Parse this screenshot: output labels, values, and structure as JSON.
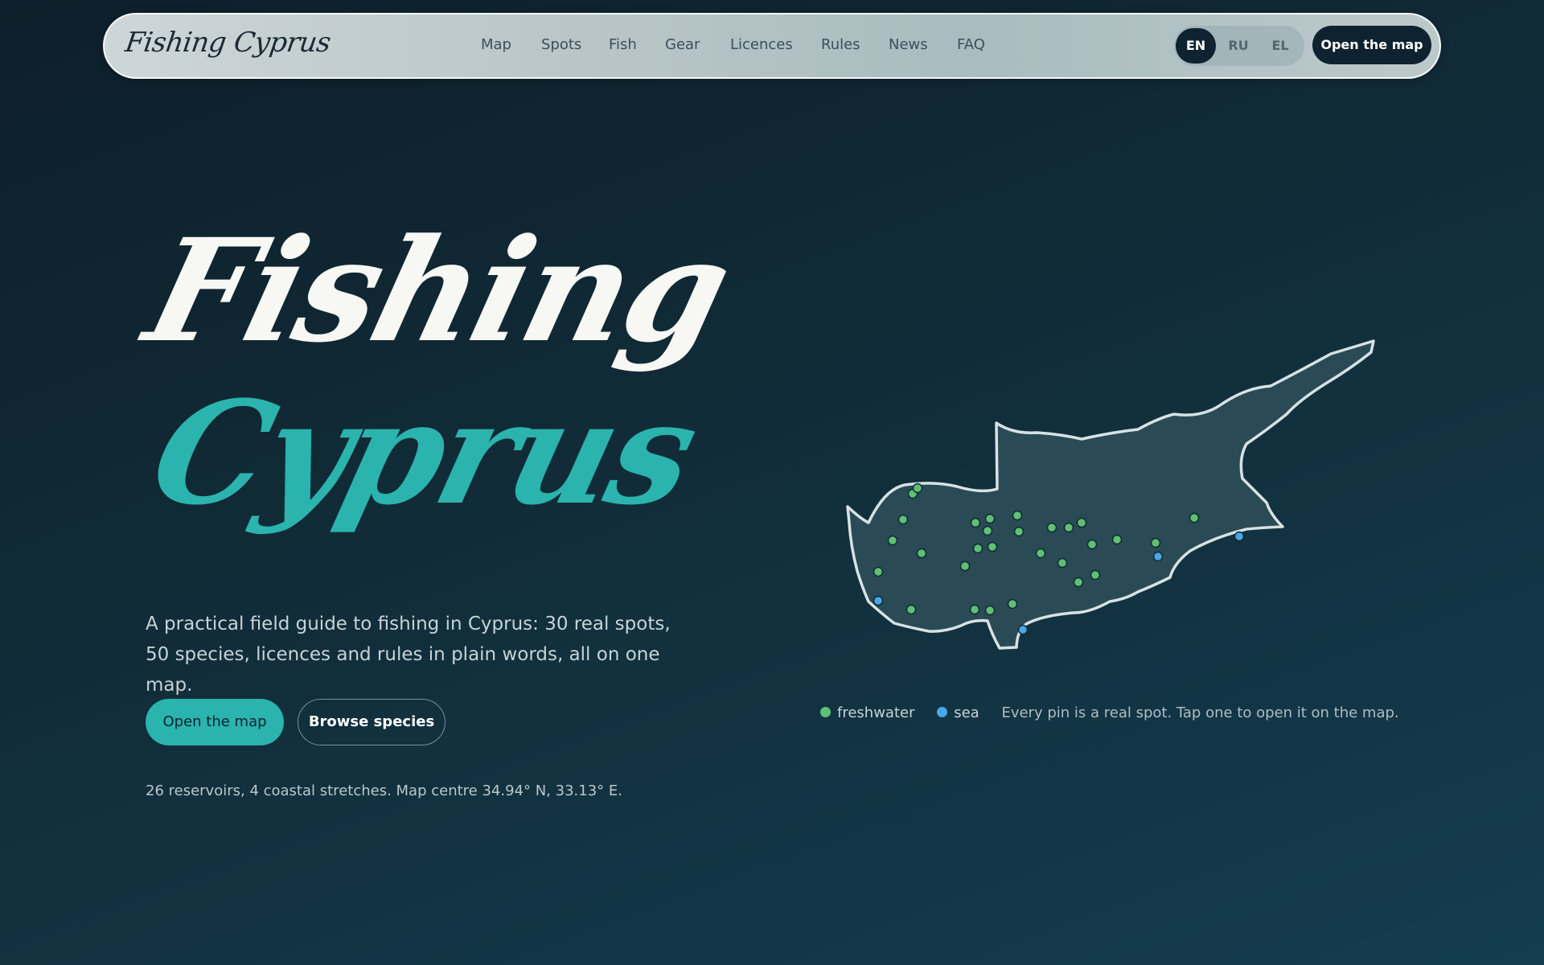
{
  "header": {
    "brand": "Fishing Cyprus",
    "nav": [
      "Map",
      "Spots",
      "Fish",
      "Gear",
      "Licences",
      "Rules",
      "News",
      "FAQ"
    ],
    "languages": [
      {
        "code": "EN",
        "active": true
      },
      {
        "code": "RU",
        "active": false
      },
      {
        "code": "EL",
        "active": false
      }
    ],
    "cta_label": "Open the map"
  },
  "hero": {
    "title_line1": "Fishing",
    "title_line2": "Cyprus",
    "lead": "A practical field guide to fishing in Cyprus: 30 real spots, 50 species, licences and rules in plain words, all on one map.",
    "primary_button": "Open the map",
    "secondary_button": "Browse species",
    "stats": "26 reservoirs, 4 coastal stretches. Map centre 34.94° N, 33.13° E."
  },
  "map": {
    "legend": {
      "freshwater": "freshwater",
      "sea": "sea",
      "note": "Every pin is a real spot. Tap one to open it on the map."
    },
    "colors": {
      "freshwater": "#5fbf73",
      "sea": "#4aa6e6",
      "island_fill": "#2a4a55",
      "outline": "#d7e2e5",
      "accent": "#2bb3ad"
    }
  }
}
